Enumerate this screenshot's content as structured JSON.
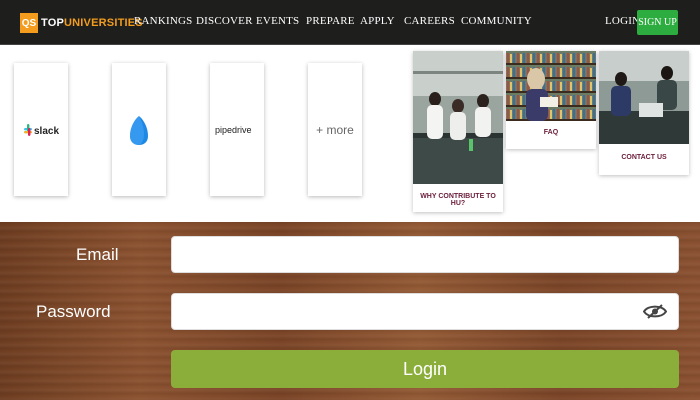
{
  "nav": {
    "logo_mark": "QS",
    "logo_top": "TOP",
    "logo_universities": "UNIVERSITIES",
    "links": [
      "RANKINGS",
      "DISCOVER",
      "EVENTS",
      "PREPARE",
      "APPLY",
      "CAREERS",
      "COMMUNITY"
    ],
    "login": "LOGIN",
    "signup": "SIGN UP"
  },
  "integrations": {
    "slack": "slack",
    "onedrive_icon": "onedrive-icon",
    "pipedrive": "pipedrive",
    "more": "+ more"
  },
  "tiles": {
    "contribute": "WHY CONTRIBUTE TO HU?",
    "faq": "FAQ",
    "contact": "CONTACT US"
  },
  "form": {
    "email_label": "Email",
    "email_value": "",
    "password_label": "Password",
    "password_value": "",
    "login_button": "Login"
  },
  "colors": {
    "nav_bg": "#1e1f1d",
    "brand_orange": "#f39c1e",
    "signup_green": "#2dad3f",
    "login_green": "#8bae3b",
    "caption_maroon": "#6b1d3a"
  }
}
